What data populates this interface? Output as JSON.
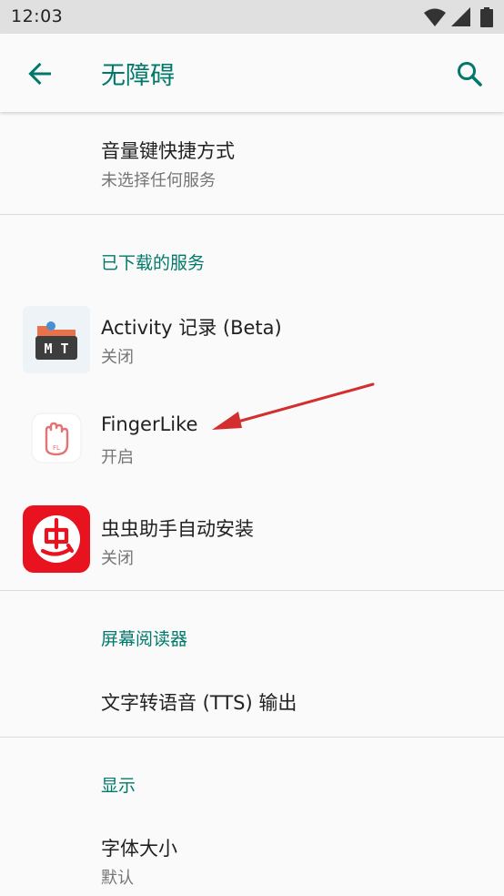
{
  "status_bar": {
    "time": "12:03"
  },
  "app_bar": {
    "title": "无障碍"
  },
  "shortcut_item": {
    "title": "音量键快捷方式",
    "summary": "未选择任何服务"
  },
  "downloaded_services": {
    "header": "已下载的服务",
    "items": [
      {
        "title": "Activity 记录 (Beta)",
        "summary": "关闭",
        "icon_text": "M T"
      },
      {
        "title": "FingerLike",
        "summary": "开启",
        "icon_text": "FL"
      },
      {
        "title": "虫虫助手自动安装",
        "summary": "关闭"
      }
    ]
  },
  "screen_readers": {
    "header": "屏幕阅读器",
    "items": [
      {
        "title": "文字转语音 (TTS) 输出"
      }
    ]
  },
  "display": {
    "header": "显示",
    "items": [
      {
        "title": "字体大小",
        "summary": "默认"
      }
    ]
  },
  "colors": {
    "accent": "#00796b",
    "arrow": "#d32f2f"
  }
}
